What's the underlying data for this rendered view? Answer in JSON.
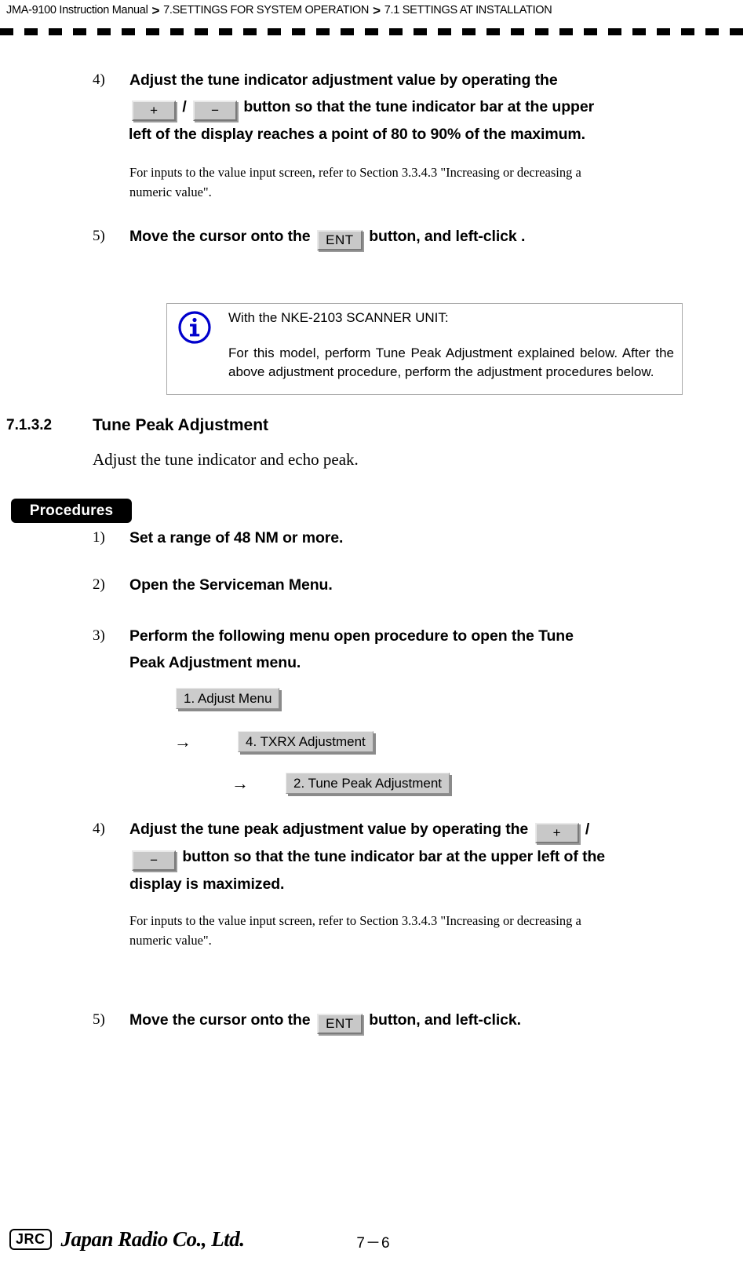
{
  "header": {
    "breadcrumb": [
      "JMA-9100 Instruction Manual",
      "7.SETTINGS FOR SYSTEM OPERATION",
      "7.1  SETTINGS AT INSTALLATION"
    ],
    "separator": ">"
  },
  "keys": {
    "plus": "+",
    "minus": "−",
    "ent": "ENT",
    "slash": "/"
  },
  "step4_top": {
    "number": "4)",
    "line1": "Adjust the tune indicator adjustment value by operating the",
    "line2_after_keys": "button so that the tune indicator bar at the upper",
    "line3": "left of the display reaches a point of 80 to 90% of the maximum.",
    "note_line1": "For inputs to the value input screen, refer to Section 3.3.4.3 \"Increasing or decreasing a",
    "note_line2": "numeric value\"."
  },
  "step5_top": {
    "number": "5)",
    "before_key": "Move the cursor onto the",
    "after_key": "button, and left-click ."
  },
  "info_box": {
    "icon": "info-circle-icon",
    "icon_color": "#0000CC",
    "title": "With the NKE-2103 SCANNER UNIT:",
    "body": "For this model, perform Tune Peak Adjustment explained below. After the above adjustment procedure, perform the adjustment procedures below."
  },
  "section": {
    "number": "7.1.3.2",
    "title": "Tune Peak Adjustment",
    "lead": "Adjust the tune indicator and echo peak."
  },
  "procedures_badge": "Procedures",
  "steps": [
    {
      "number": "1)",
      "text": "Set a range of 48 NM or more."
    },
    {
      "number": "2)",
      "text": "Open the Serviceman Menu."
    },
    {
      "number": "3)",
      "line1": "Perform the following menu open procedure to open the Tune",
      "line2": "Peak Adjustment menu."
    }
  ],
  "menu_path": {
    "arrow": "→",
    "items": [
      "1. Adjust Menu",
      "4. TXRX Adjustment",
      "2. Tune Peak Adjustment"
    ]
  },
  "step4_bottom": {
    "number": "4)",
    "line1": "Adjust the tune peak adjustment value by operating the",
    "line2_after_keys": "button so that the tune indicator bar at the upper left of the",
    "line3": "display is maximized.",
    "note_line1": "For inputs to the value input screen, refer to Section 3.3.4.3 \"Increasing or decreasing a",
    "note_line2": "numeric value\"."
  },
  "step5_bottom": {
    "number": "5)",
    "before_key": "Move the cursor onto the",
    "after_key": "button, and left-click."
  },
  "footer": {
    "logo_box": "JRC",
    "logo_text": "Japan Radio Co., Ltd.",
    "page_number": "7－6"
  }
}
